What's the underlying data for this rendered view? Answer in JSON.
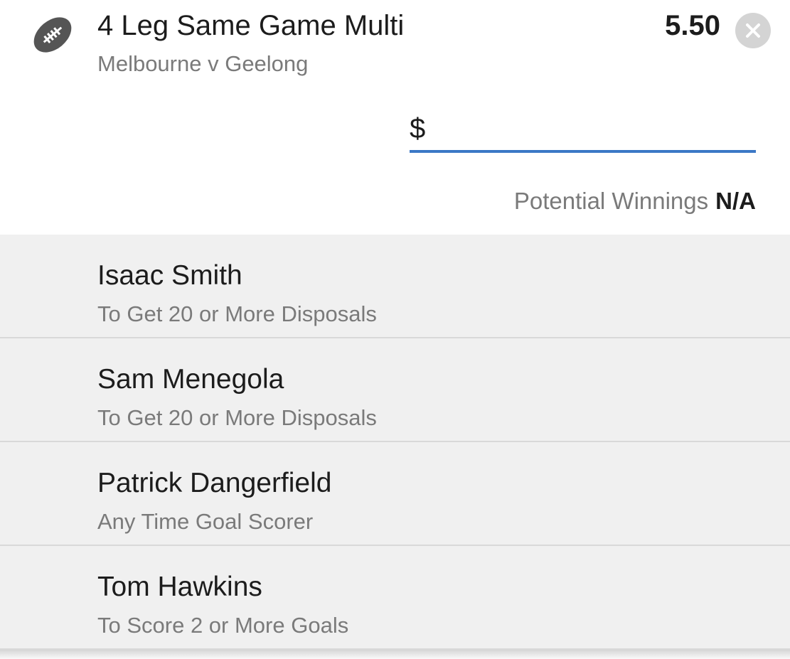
{
  "bet": {
    "icon": "football-icon",
    "title": "4 Leg Same Game Multi",
    "match": "Melbourne v Geelong",
    "odds": "5.50",
    "close_icon": "close-icon"
  },
  "stake": {
    "currency_symbol": "$",
    "value": "",
    "placeholder": ""
  },
  "winnings": {
    "label": "Potential Winnings",
    "value": "N/A"
  },
  "legs": [
    {
      "player": "Isaac Smith",
      "market": "To Get 20 or More Disposals"
    },
    {
      "player": "Sam Menegola",
      "market": "To Get 20 or More Disposals"
    },
    {
      "player": "Patrick Dangerfield",
      "market": "Any Time Goal Scorer"
    },
    {
      "player": "Tom Hawkins",
      "market": "To Score 2 or More Goals"
    }
  ],
  "colors": {
    "accent": "#3b78c6",
    "muted_text": "#7a7a7a",
    "leg_background": "#f0f0f0",
    "close_button": "#d4d4d4"
  }
}
